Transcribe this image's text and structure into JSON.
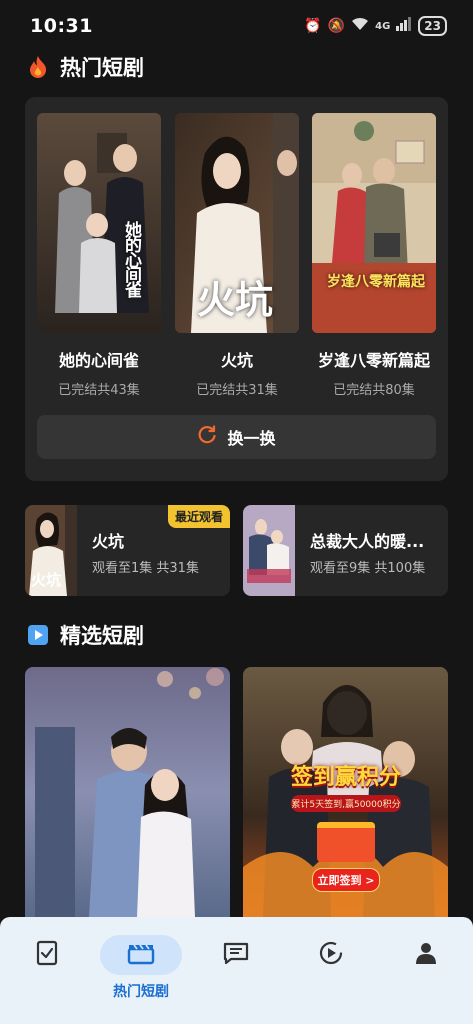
{
  "status_bar": {
    "time": "10:31",
    "network": "4G",
    "battery": "23"
  },
  "hot_section": {
    "title": "热门短剧",
    "items": [
      {
        "title": "她的心间雀",
        "meta": "已完结共43集",
        "poster_text": "她的心间雀"
      },
      {
        "title": "火坑",
        "meta": "已完结共31集",
        "poster_text": "火坑"
      },
      {
        "title": "岁逢八零新篇起",
        "meta": "已完结共80集",
        "poster_text": "岁逢八零新篇起"
      }
    ],
    "refresh_label": "换一换"
  },
  "recent": [
    {
      "title": "火坑",
      "meta": "观看至1集 共31集",
      "badge": "最近观看"
    },
    {
      "title": "总裁大人的暖...",
      "meta": "观看至9集 共100集"
    }
  ],
  "featured_section": {
    "title": "精选短剧",
    "promo": {
      "headline": "签到赢积分",
      "sub": "累计5天签到,赢50000积分",
      "button": "立即签到 >"
    }
  },
  "bottom_nav": {
    "items": [
      {
        "icon": "task-check-icon",
        "label": ""
      },
      {
        "icon": "clapperboard-icon",
        "label": "热门短剧"
      },
      {
        "icon": "message-icon",
        "label": ""
      },
      {
        "icon": "play-history-icon",
        "label": ""
      },
      {
        "icon": "person-icon",
        "label": ""
      }
    ]
  },
  "colors": {
    "accent": "#1a6fd1",
    "badge": "#f2c230",
    "refresh_icon": "#f26a2e"
  }
}
